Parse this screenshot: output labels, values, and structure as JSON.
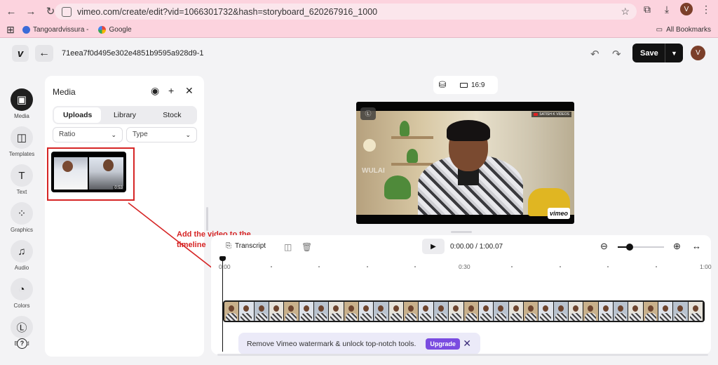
{
  "browser": {
    "url": "vimeo.com/create/edit?vid=1066301732&hash=storyboard_620267916_1000",
    "profile_initial": "V",
    "bookmarks": [
      {
        "label": "Tangoardvissura -",
        "color": "#3b6bd8"
      },
      {
        "label": "Google",
        "color": "#e8453c"
      }
    ],
    "all_bookmarks": "All Bookmarks"
  },
  "header": {
    "project_id": "71eea7f0d495e302e4851b9595a928d9-1",
    "save_label": "Save",
    "user_initial": "V"
  },
  "rail": [
    {
      "label": "Media",
      "icon": "image-icon",
      "glyph": "▣",
      "active": true
    },
    {
      "label": "Templates",
      "icon": "templates-icon",
      "glyph": "◫",
      "active": false
    },
    {
      "label": "Text",
      "icon": "text-icon",
      "glyph": "T",
      "active": false
    },
    {
      "label": "Graphics",
      "icon": "graphics-icon",
      "glyph": "⁘",
      "active": false
    },
    {
      "label": "Audio",
      "icon": "music-icon",
      "glyph": "♫",
      "active": false
    },
    {
      "label": "Colors",
      "icon": "palette-icon",
      "glyph": "◔",
      "active": false
    },
    {
      "label": "Brand",
      "icon": "brand-icon",
      "glyph": "Ⓛ",
      "active": false
    }
  ],
  "media_panel": {
    "title": "Media",
    "tabs": [
      "Uploads",
      "Library",
      "Stock"
    ],
    "active_tab": 0,
    "ratio_placeholder": "Ratio",
    "type_placeholder": "Type",
    "thumb_duration": "0:53"
  },
  "annotation": {
    "text": "Add the video to the timeline",
    "color": "#d62525"
  },
  "preview": {
    "aspect_ratio": "16:9",
    "watermark_left": "WULAI",
    "channel_tag": "SATISH K VIDEOS",
    "vimeo_watermark": "vimeo",
    "corner_badge": "Ⓛ"
  },
  "timeline": {
    "transcript_label": "Transcript",
    "current_time": "0:00.00",
    "total_time": "1:00.07",
    "ruler_labels": [
      "0:00",
      "0:30",
      "1:00"
    ],
    "zoom_level": 0.25,
    "frame_count": 32
  },
  "upgrade": {
    "message": "Remove Vimeo watermark & unlock top-notch tools.",
    "button_label": "Upgrade",
    "accent": "#7a4ce0"
  }
}
